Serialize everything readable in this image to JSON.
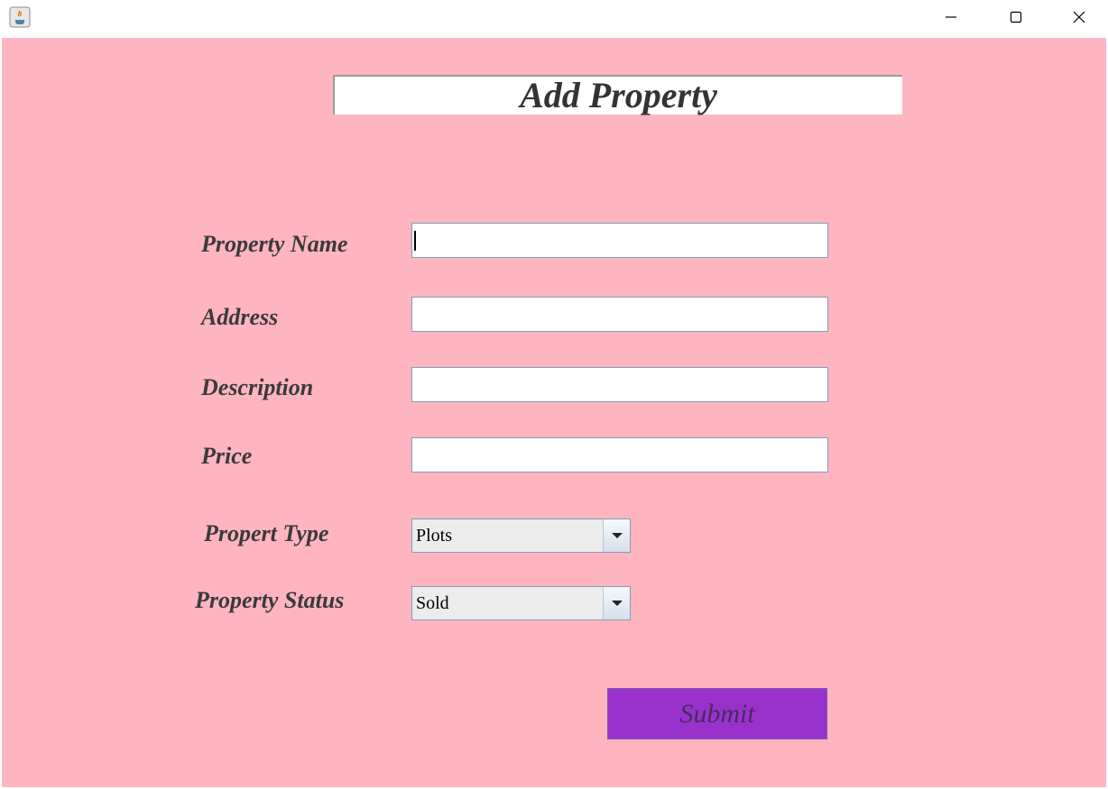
{
  "window": {
    "controls": {
      "minimize_icon": "minimize-icon",
      "maximize_icon": "maximize-icon",
      "close_icon": "close-icon"
    }
  },
  "form": {
    "title": "Add Property",
    "background_color": "#ffb5c0",
    "fields": {
      "property_name": {
        "label": "Property Name",
        "value": ""
      },
      "address": {
        "label": "Address",
        "value": ""
      },
      "description": {
        "label": "Description",
        "value": ""
      },
      "price": {
        "label": "Price",
        "value": ""
      }
    },
    "selects": {
      "property_type": {
        "label": "Propert Type",
        "selected": "Plots"
      },
      "property_status": {
        "label": "Property Status",
        "selected": "Sold"
      }
    },
    "submit": {
      "label": "Submit",
      "color": "#9932cc"
    }
  }
}
